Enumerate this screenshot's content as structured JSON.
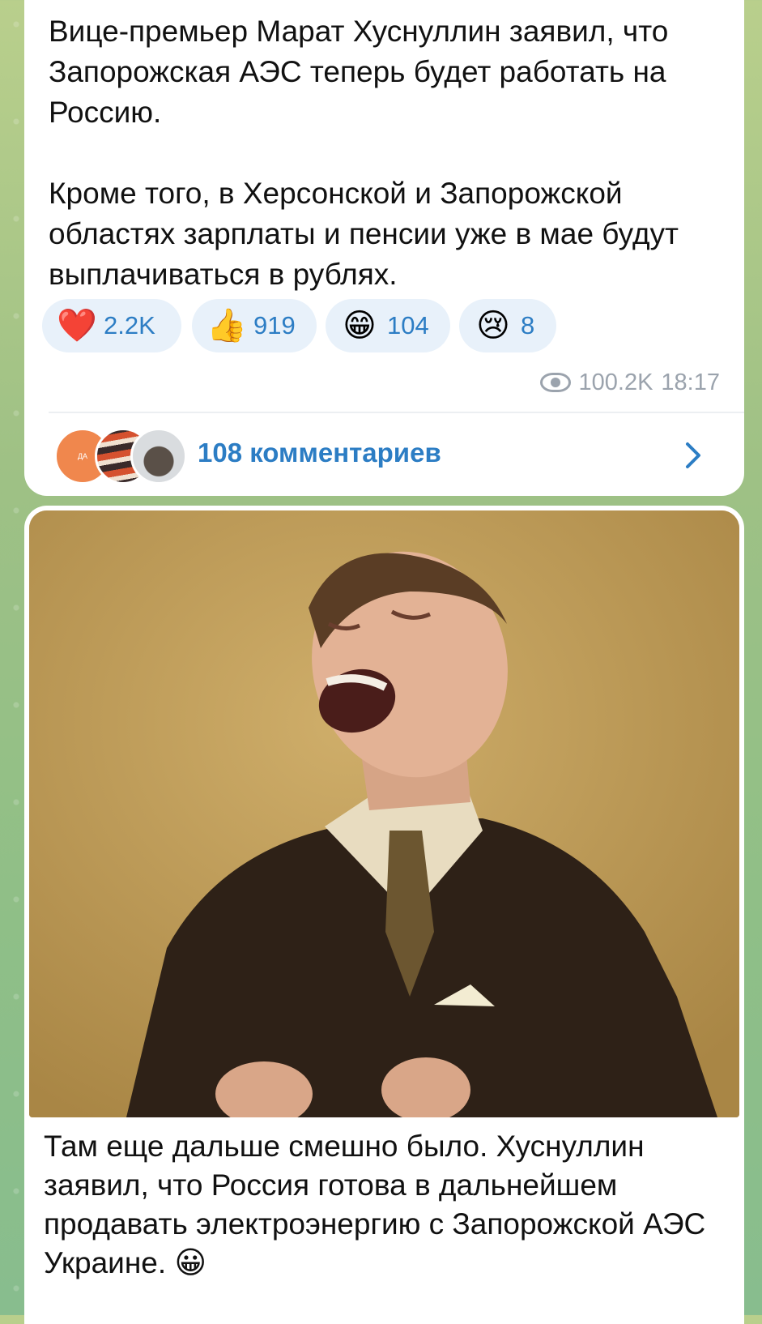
{
  "post1": {
    "text": "Вице-премьер Марат Хуснуллин заявил, что Запорожская АЭС теперь будет работать на Россию.\n\nКроме того, в Херсонской и Запорожской областях зарплаты и пенсии уже в мае будут выплачиваться в рублях.",
    "reactions": [
      {
        "emoji": "❤️",
        "count": "2.2K"
      },
      {
        "emoji": "👍",
        "count": "919"
      },
      {
        "emoji": "😁",
        "count": "104"
      },
      {
        "emoji": "😢",
        "count": "8"
      }
    ],
    "views": "100.2K",
    "time": "18:17",
    "comments": {
      "avatar_initials": "ДА",
      "label": "108 комментариев"
    }
  },
  "post2": {
    "text": "Там еще дальше смешно было. Хуснуллин заявил, что Россия готова в дальнейшем продавать электроэнергию с Запорожской АЭС Украине.",
    "emoji": "😀"
  }
}
